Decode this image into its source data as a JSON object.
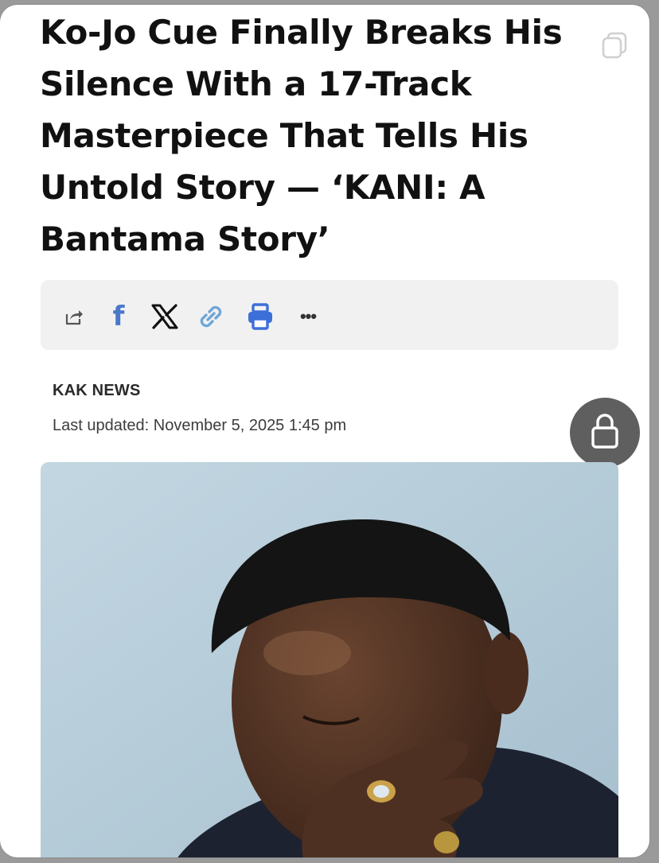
{
  "article": {
    "headline": "Ko-Jo Cue Finally Breaks His Silence With a 17-Track Masterpiece That Tells His Untold Story — ‘KANI: A Bantama Story’",
    "byline": "KAK NEWS",
    "updated": "Last updated: November 5, 2025 1:45 pm"
  },
  "share_bar": {
    "buttons": [
      "share-icon",
      "facebook-icon",
      "x-icon",
      "link-icon",
      "print-icon",
      "more-icon"
    ],
    "facebook_glyph": "f",
    "x_glyph": "𝕏",
    "more_glyph": "•••"
  },
  "colors": {
    "facebook": "#4a78c9",
    "link": "#6fa7d6",
    "print": "#3d6fd8",
    "share_bar_bg": "#f1f1f1",
    "lock_button": "#5f5f5f"
  },
  "hero_image": {
    "alt": "Ko-Jo Cue portrait"
  }
}
